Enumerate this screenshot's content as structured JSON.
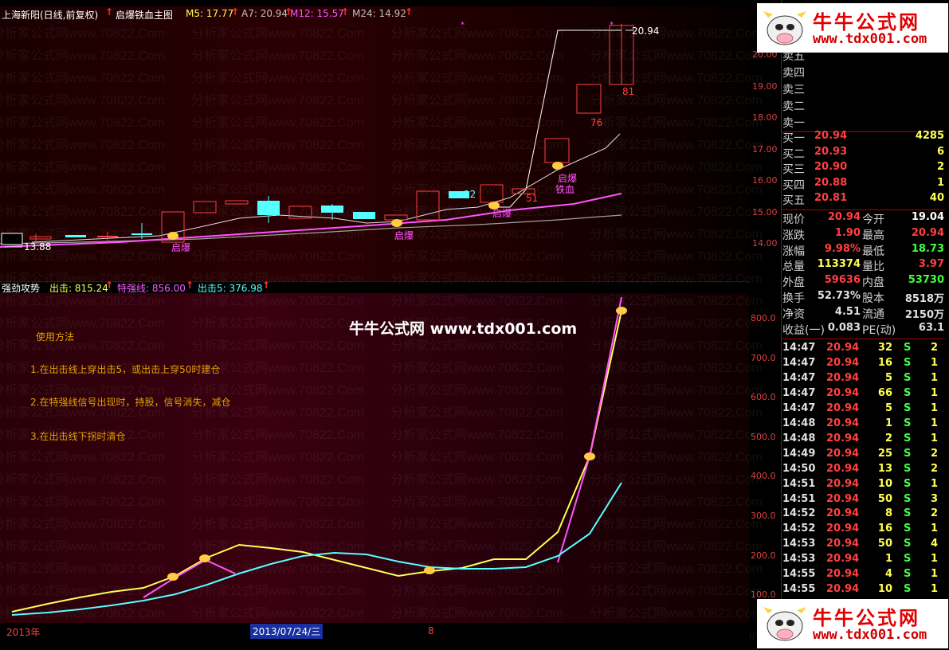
{
  "main_header": {
    "stock": "上海新阳(日线,前复权)",
    "indicator": "启爆铁血主图",
    "ma5": "M5: 17.77",
    "ma7": "A7: 20.94",
    "ma12": "M12: 15.57",
    "ma24": "M24: 14.92"
  },
  "sub_header": {
    "name": "强劲攻势",
    "attack": "出击: 815.24",
    "strong": "特强线: 856.00",
    "attack5": "出击5: 376.98"
  },
  "top_chart_labels": {
    "high_price": "20.94",
    "low_price": "13.88",
    "num_81": "81",
    "num_76": "76",
    "num_12": "12",
    "num_51": "51",
    "qibao": "启爆",
    "tiexue": "铁血"
  },
  "price_axis_top": [
    "20.00",
    "19.00",
    "18.00",
    "17.00",
    "16.00",
    "15.00",
    "14.00"
  ],
  "price_axis_bottom": [
    "800.0",
    "700.0",
    "600.0",
    "500.0",
    "400.0",
    "300.0",
    "200.0",
    "100.0"
  ],
  "usage": {
    "title": "使用方法",
    "line1": "1.在出击线上穿出击5，或出击上穿50时建仓",
    "line2": "2.在特强线信号出现时，持股，信号消失，减仓",
    "line3": "3.在出击线下拐时清仓"
  },
  "bottom_bar": {
    "year": "2013年",
    "date": "2013/07/24/三",
    "num": "8"
  },
  "center_watermark": "牛牛公式网 www.tdx001.com",
  "watermark_text": "分析家公式网www.70822.Com",
  "logo": {
    "title": "牛牛公式网",
    "url": "www.tdx001.com"
  },
  "sell_levels": [
    "卖五",
    "卖四",
    "卖三",
    "卖二",
    "卖一"
  ],
  "buy_levels": [
    {
      "label": "买一",
      "price": "20.94",
      "vol": "4285"
    },
    {
      "label": "买二",
      "price": "20.93",
      "vol": "6"
    },
    {
      "label": "买三",
      "price": "20.90",
      "vol": "2"
    },
    {
      "label": "买四",
      "price": "20.88",
      "vol": "1"
    },
    {
      "label": "买五",
      "price": "20.81",
      "vol": "40"
    }
  ],
  "stats": [
    {
      "l1": "现价",
      "v1": "20.94",
      "c1": "#ff4040",
      "l2": "今开",
      "v2": "19.04",
      "c2": "#ffffff"
    },
    {
      "l1": "涨跌",
      "v1": "1.90",
      "c1": "#ff4040",
      "l2": "最高",
      "v2": "20.94",
      "c2": "#ff4040"
    },
    {
      "l1": "涨幅",
      "v1": "9.98%",
      "c1": "#ff4040",
      "l2": "最低",
      "v2": "18.73",
      "c2": "#40ff40"
    },
    {
      "l1": "总量",
      "v1": "113374",
      "c1": "#ffff55",
      "l2": "量比",
      "v2": "3.97",
      "c2": "#ff4040"
    },
    {
      "l1": "外盘",
      "v1": "59636",
      "c1": "#ff4040",
      "l2": "内盘",
      "v2": "53730",
      "c2": "#40ff40"
    },
    {
      "l1": "换手",
      "v1": "52.73%",
      "c1": "#e0e0e0",
      "l2": "股本",
      "v2": "8518万",
      "c2": "#e0e0e0"
    },
    {
      "l1": "净资",
      "v1": "4.51",
      "c1": "#e0e0e0",
      "l2": "流通",
      "v2": "2150万",
      "c2": "#e0e0e0"
    },
    {
      "l1": "收益(一)",
      "v1": "0.083",
      "c1": "#e0e0e0",
      "l2": "PE(动)",
      "v2": "63.1",
      "c2": "#e0e0e0"
    }
  ],
  "ticks": [
    {
      "t": "14:47",
      "p": "20.94",
      "v": "32",
      "s": "S",
      "n": "2"
    },
    {
      "t": "14:47",
      "p": "20.94",
      "v": "16",
      "s": "S",
      "n": "1"
    },
    {
      "t": "14:47",
      "p": "20.94",
      "v": "5",
      "s": "S",
      "n": "1"
    },
    {
      "t": "14:47",
      "p": "20.94",
      "v": "66",
      "s": "S",
      "n": "1"
    },
    {
      "t": "14:47",
      "p": "20.94",
      "v": "5",
      "s": "S",
      "n": "1"
    },
    {
      "t": "14:48",
      "p": "20.94",
      "v": "1",
      "s": "S",
      "n": "1"
    },
    {
      "t": "14:48",
      "p": "20.94",
      "v": "2",
      "s": "S",
      "n": "1"
    },
    {
      "t": "14:49",
      "p": "20.94",
      "v": "25",
      "s": "S",
      "n": "2"
    },
    {
      "t": "14:50",
      "p": "20.94",
      "v": "13",
      "s": "S",
      "n": "2"
    },
    {
      "t": "14:51",
      "p": "20.94",
      "v": "10",
      "s": "S",
      "n": "1"
    },
    {
      "t": "14:51",
      "p": "20.94",
      "v": "50",
      "s": "S",
      "n": "3"
    },
    {
      "t": "14:52",
      "p": "20.94",
      "v": "8",
      "s": "S",
      "n": "2"
    },
    {
      "t": "14:52",
      "p": "20.94",
      "v": "16",
      "s": "S",
      "n": "1"
    },
    {
      "t": "14:53",
      "p": "20.94",
      "v": "50",
      "s": "S",
      "n": "4"
    },
    {
      "t": "14:53",
      "p": "20.94",
      "v": "1",
      "s": "S",
      "n": "1"
    },
    {
      "t": "14:55",
      "p": "20.94",
      "v": "4",
      "s": "S",
      "n": "1"
    },
    {
      "t": "14:55",
      "p": "20.94",
      "v": "10",
      "s": "S",
      "n": "1"
    }
  ],
  "colors": {
    "up": "#ff4040",
    "down": "#55ffff",
    "ma5": "#ffffff",
    "ma_m12": "#ff55ff",
    "ma_m24": "#c0c0c0",
    "attack": "#ffff55",
    "strong": "#ff55ff",
    "attack5": "#55ffff"
  }
}
